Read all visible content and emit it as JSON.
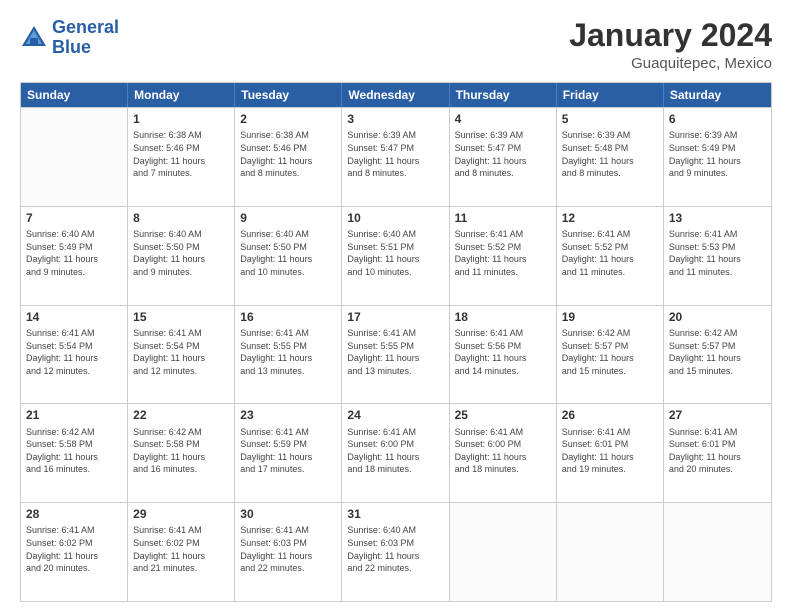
{
  "header": {
    "logo_line1": "General",
    "logo_line2": "Blue",
    "month_title": "January 2024",
    "location": "Guaquitepec, Mexico"
  },
  "days_of_week": [
    "Sunday",
    "Monday",
    "Tuesday",
    "Wednesday",
    "Thursday",
    "Friday",
    "Saturday"
  ],
  "weeks": [
    [
      {
        "day": "",
        "info": ""
      },
      {
        "day": "1",
        "info": "Sunrise: 6:38 AM\nSunset: 5:46 PM\nDaylight: 11 hours\nand 7 minutes."
      },
      {
        "day": "2",
        "info": "Sunrise: 6:38 AM\nSunset: 5:46 PM\nDaylight: 11 hours\nand 8 minutes."
      },
      {
        "day": "3",
        "info": "Sunrise: 6:39 AM\nSunset: 5:47 PM\nDaylight: 11 hours\nand 8 minutes."
      },
      {
        "day": "4",
        "info": "Sunrise: 6:39 AM\nSunset: 5:47 PM\nDaylight: 11 hours\nand 8 minutes."
      },
      {
        "day": "5",
        "info": "Sunrise: 6:39 AM\nSunset: 5:48 PM\nDaylight: 11 hours\nand 8 minutes."
      },
      {
        "day": "6",
        "info": "Sunrise: 6:39 AM\nSunset: 5:49 PM\nDaylight: 11 hours\nand 9 minutes."
      }
    ],
    [
      {
        "day": "7",
        "info": "Sunrise: 6:40 AM\nSunset: 5:49 PM\nDaylight: 11 hours\nand 9 minutes."
      },
      {
        "day": "8",
        "info": "Sunrise: 6:40 AM\nSunset: 5:50 PM\nDaylight: 11 hours\nand 9 minutes."
      },
      {
        "day": "9",
        "info": "Sunrise: 6:40 AM\nSunset: 5:50 PM\nDaylight: 11 hours\nand 10 minutes."
      },
      {
        "day": "10",
        "info": "Sunrise: 6:40 AM\nSunset: 5:51 PM\nDaylight: 11 hours\nand 10 minutes."
      },
      {
        "day": "11",
        "info": "Sunrise: 6:41 AM\nSunset: 5:52 PM\nDaylight: 11 hours\nand 11 minutes."
      },
      {
        "day": "12",
        "info": "Sunrise: 6:41 AM\nSunset: 5:52 PM\nDaylight: 11 hours\nand 11 minutes."
      },
      {
        "day": "13",
        "info": "Sunrise: 6:41 AM\nSunset: 5:53 PM\nDaylight: 11 hours\nand 11 minutes."
      }
    ],
    [
      {
        "day": "14",
        "info": "Sunrise: 6:41 AM\nSunset: 5:54 PM\nDaylight: 11 hours\nand 12 minutes."
      },
      {
        "day": "15",
        "info": "Sunrise: 6:41 AM\nSunset: 5:54 PM\nDaylight: 11 hours\nand 12 minutes."
      },
      {
        "day": "16",
        "info": "Sunrise: 6:41 AM\nSunset: 5:55 PM\nDaylight: 11 hours\nand 13 minutes."
      },
      {
        "day": "17",
        "info": "Sunrise: 6:41 AM\nSunset: 5:55 PM\nDaylight: 11 hours\nand 13 minutes."
      },
      {
        "day": "18",
        "info": "Sunrise: 6:41 AM\nSunset: 5:56 PM\nDaylight: 11 hours\nand 14 minutes."
      },
      {
        "day": "19",
        "info": "Sunrise: 6:42 AM\nSunset: 5:57 PM\nDaylight: 11 hours\nand 15 minutes."
      },
      {
        "day": "20",
        "info": "Sunrise: 6:42 AM\nSunset: 5:57 PM\nDaylight: 11 hours\nand 15 minutes."
      }
    ],
    [
      {
        "day": "21",
        "info": "Sunrise: 6:42 AM\nSunset: 5:58 PM\nDaylight: 11 hours\nand 16 minutes."
      },
      {
        "day": "22",
        "info": "Sunrise: 6:42 AM\nSunset: 5:58 PM\nDaylight: 11 hours\nand 16 minutes."
      },
      {
        "day": "23",
        "info": "Sunrise: 6:41 AM\nSunset: 5:59 PM\nDaylight: 11 hours\nand 17 minutes."
      },
      {
        "day": "24",
        "info": "Sunrise: 6:41 AM\nSunset: 6:00 PM\nDaylight: 11 hours\nand 18 minutes."
      },
      {
        "day": "25",
        "info": "Sunrise: 6:41 AM\nSunset: 6:00 PM\nDaylight: 11 hours\nand 18 minutes."
      },
      {
        "day": "26",
        "info": "Sunrise: 6:41 AM\nSunset: 6:01 PM\nDaylight: 11 hours\nand 19 minutes."
      },
      {
        "day": "27",
        "info": "Sunrise: 6:41 AM\nSunset: 6:01 PM\nDaylight: 11 hours\nand 20 minutes."
      }
    ],
    [
      {
        "day": "28",
        "info": "Sunrise: 6:41 AM\nSunset: 6:02 PM\nDaylight: 11 hours\nand 20 minutes."
      },
      {
        "day": "29",
        "info": "Sunrise: 6:41 AM\nSunset: 6:02 PM\nDaylight: 11 hours\nand 21 minutes."
      },
      {
        "day": "30",
        "info": "Sunrise: 6:41 AM\nSunset: 6:03 PM\nDaylight: 11 hours\nand 22 minutes."
      },
      {
        "day": "31",
        "info": "Sunrise: 6:40 AM\nSunset: 6:03 PM\nDaylight: 11 hours\nand 22 minutes."
      },
      {
        "day": "",
        "info": ""
      },
      {
        "day": "",
        "info": ""
      },
      {
        "day": "",
        "info": ""
      }
    ]
  ]
}
